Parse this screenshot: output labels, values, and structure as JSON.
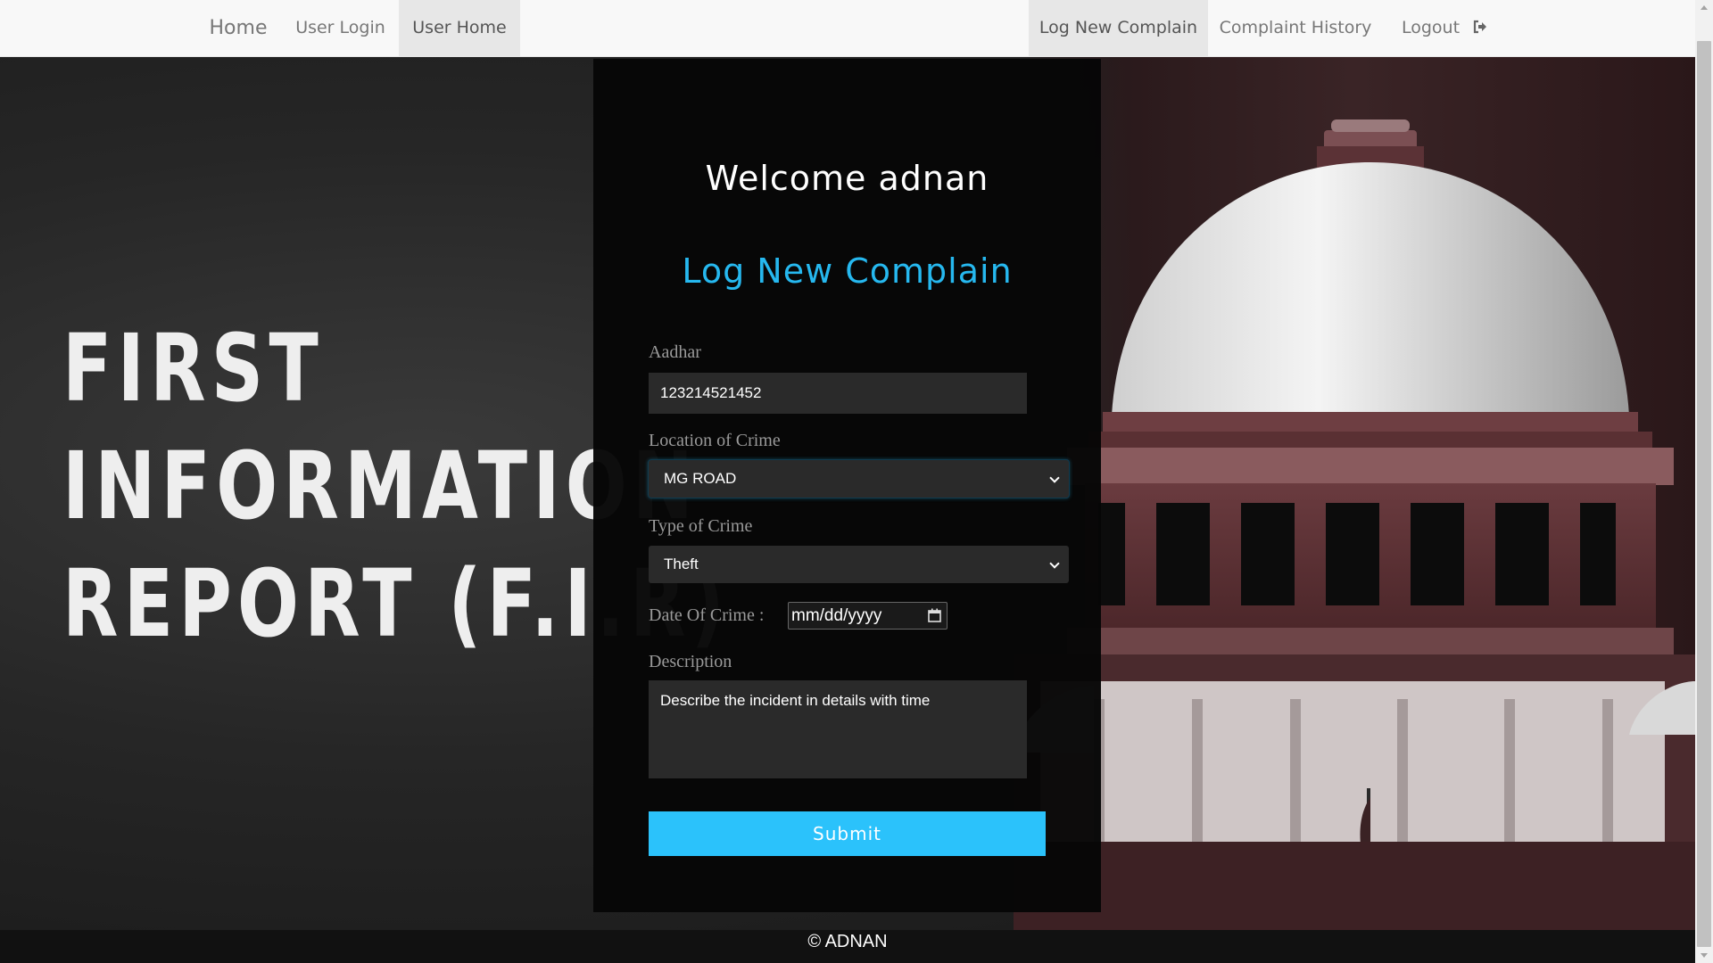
{
  "navbar": {
    "brand": "Home",
    "left_items": [
      {
        "label": "User Login",
        "active": false
      },
      {
        "label": "User Home",
        "active": true
      }
    ],
    "right_items": [
      {
        "label": "Log New Complain",
        "active": true
      },
      {
        "label": "Complaint History",
        "active": false
      },
      {
        "label": "Logout",
        "icon": "logout-icon"
      }
    ]
  },
  "hero": {
    "title_lines": [
      "FIRST",
      "INFORMATION",
      "REPORT (F.I.R)"
    ],
    "background_image": "supreme-court-building"
  },
  "form": {
    "welcome": "Welcome adnan",
    "title": "Log New Complain",
    "aadhar": {
      "label": "Aadhar",
      "value": "123214521452"
    },
    "location": {
      "label": "Location of Crime",
      "value": "MG ROAD"
    },
    "crime_type": {
      "label": "Type of Crime",
      "value": "Theft"
    },
    "date": {
      "label": "Date Of Crime :",
      "placeholder": "mm/dd/yyyy",
      "icon": "calendar-icon"
    },
    "description": {
      "label": "Description",
      "placeholder": "Describe the incident in details with time"
    },
    "submit_label": "Submit"
  },
  "footer": {
    "text": "© ADNAN"
  },
  "colors": {
    "accent": "#2bc2fb",
    "title_blue": "#26b8ef",
    "navbar_bg": "#f8f8f8",
    "panel_bg": "#060606"
  }
}
